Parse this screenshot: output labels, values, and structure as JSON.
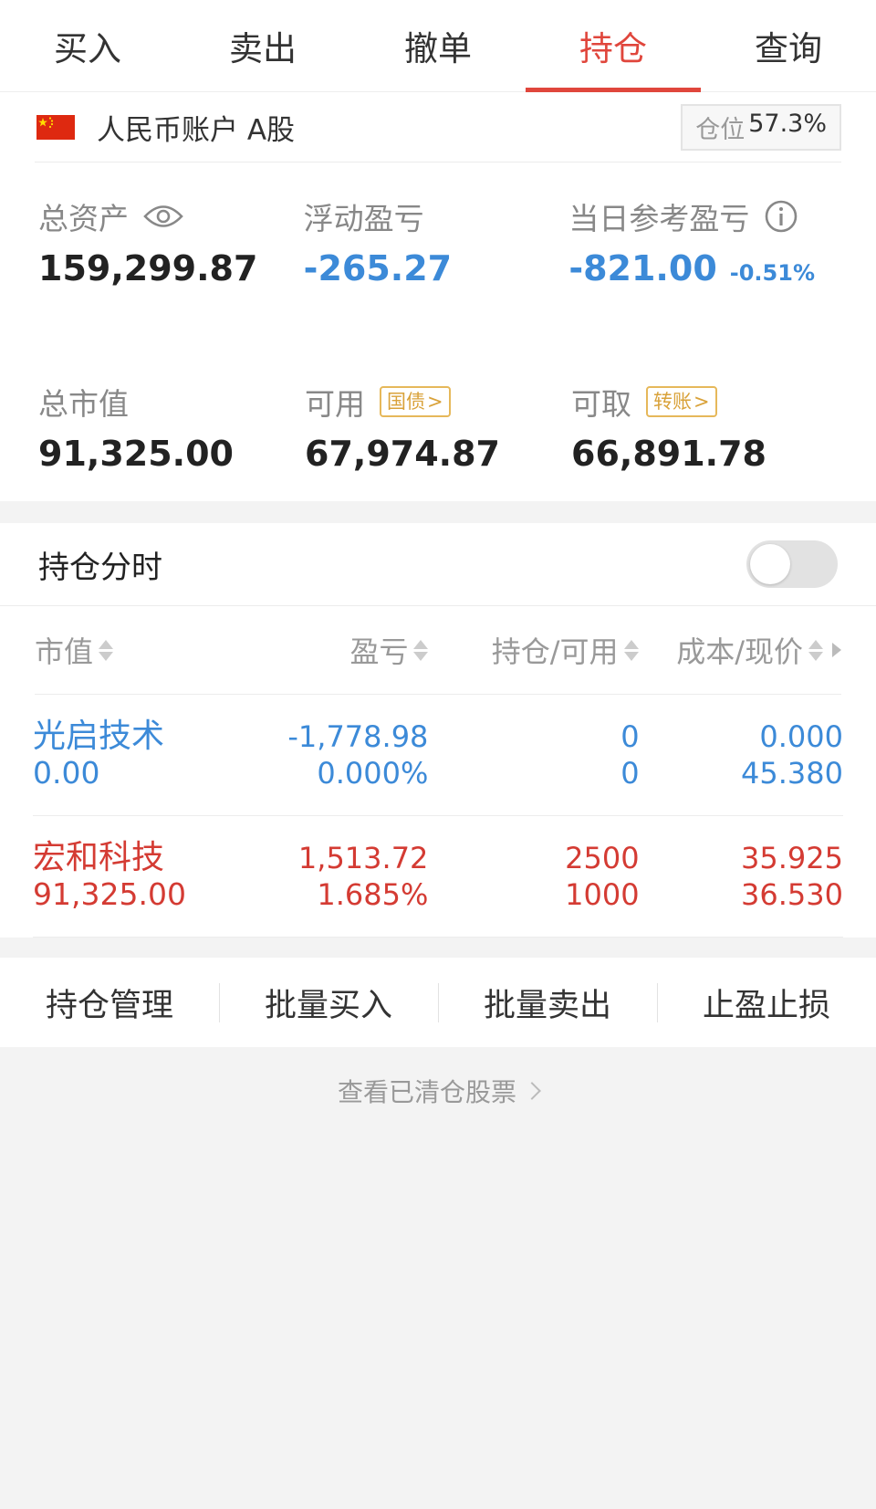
{
  "tabs": [
    {
      "label": "买入",
      "active": false
    },
    {
      "label": "卖出",
      "active": false
    },
    {
      "label": "撤单",
      "active": false
    },
    {
      "label": "持仓",
      "active": true
    },
    {
      "label": "查询",
      "active": false
    }
  ],
  "account": {
    "name": "人民币账户 A股",
    "position_label": "仓位",
    "position_value": "57.3%",
    "flag_icon": "china-flag-icon"
  },
  "stats": {
    "total_assets": {
      "label": "总资产",
      "value": "159,299.87",
      "icon": "eye-icon"
    },
    "floating_pnl": {
      "label": "浮动盈亏",
      "value": "-265.27"
    },
    "daily_pnl": {
      "label": "当日参考盈亏",
      "value": "-821.00",
      "pct": "-0.51%",
      "icon": "info-icon"
    },
    "market_value": {
      "label": "总市值",
      "value": "91,325.00"
    },
    "available": {
      "label": "可用",
      "value": "67,974.87",
      "chip": "国债"
    },
    "withdrawable": {
      "label": "可取",
      "value": "66,891.78",
      "chip": "转账"
    }
  },
  "holding_timeshare": {
    "label": "持仓分时",
    "enabled": false
  },
  "table": {
    "headers": [
      "市值",
      "盈亏",
      "持仓/可用",
      "成本/现价"
    ],
    "rows": [
      {
        "name": "光启技术",
        "market_value": "0.00",
        "pnl": "-1,778.98",
        "pnl_pct": "0.000%",
        "hold": "0",
        "avail": "0",
        "cost": "0.000",
        "price": "45.380",
        "tone": "blue"
      },
      {
        "name": "宏和科技",
        "market_value": "91,325.00",
        "pnl": "1,513.72",
        "pnl_pct": "1.685%",
        "hold": "2500",
        "avail": "1000",
        "cost": "35.925",
        "price": "36.530",
        "tone": "red"
      }
    ]
  },
  "actions": [
    "持仓管理",
    "批量买入",
    "批量卖出",
    "止盈止损"
  ],
  "cleared_link": "查看已清仓股票",
  "colors": {
    "accent": "#e0463c",
    "loss": "#3c8ad8",
    "gain": "#d43b33",
    "chip": "#e6b85a"
  }
}
